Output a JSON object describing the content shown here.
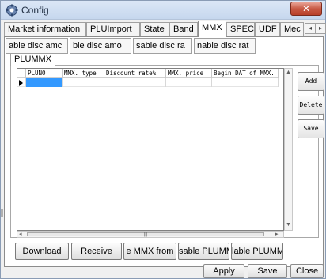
{
  "window": {
    "title": "Config",
    "close_glyph": "✕"
  },
  "tabs": [
    "Market information",
    "PLUImport",
    "State",
    "Band",
    "MMX",
    "SPEC",
    "UDF",
    "Mec"
  ],
  "active_tab": "MMX",
  "tab_scroll": {
    "left": "◂",
    "right": "▸"
  },
  "subtabs": [
    "able disc amc",
    "ble disc amo",
    "sable disc ra",
    "nable disc rat"
  ],
  "section_tab": "PLUMMX",
  "grid": {
    "columns": [
      "PLUNO",
      "MMX. type",
      "Discount rate%",
      "MMX. price",
      "Begin DAT of MMX."
    ]
  },
  "scroll": {
    "up": "▲",
    "down": "▼",
    "left": "◂",
    "right": "▸",
    "thumb_grip": "|||"
  },
  "side_buttons": [
    "Add",
    "Delete",
    "Save"
  ],
  "bottom_buttons": [
    "Download",
    "Receive",
    "e MMX from",
    "sable PLUMM",
    "lable PLUMM"
  ],
  "footer_buttons": [
    "Apply",
    "Save",
    "Close"
  ],
  "icons": {
    "app": "gear-icon"
  }
}
